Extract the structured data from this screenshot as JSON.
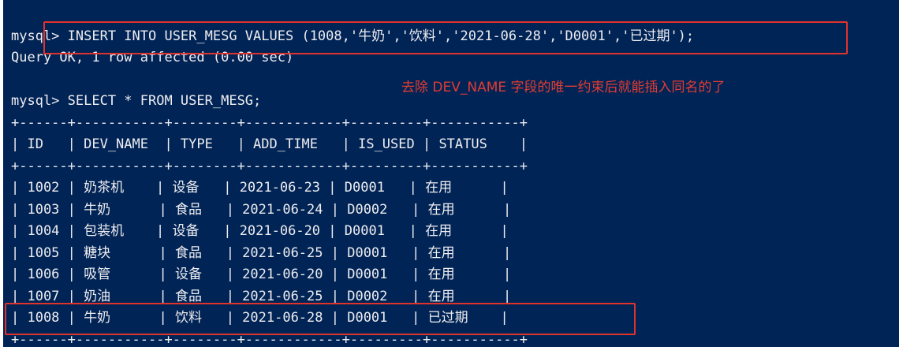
{
  "terminal": {
    "insert_command": "mysql> INSERT INTO USER_MESG VALUES (1008,'牛奶','饮料','2021-06-28','D0001','已过期');",
    "insert_result": "Query OK, 1 row affected (0.00 sec)",
    "select_command": "mysql> SELECT * FROM USER_MESG;",
    "separator": "+------+-----------+--------+------------+---------+-----------+",
    "header_row": "| ID   | DEV_NAME  | TYPE   | ADD_TIME   | IS_USED | STATUS    |",
    "columns": [
      "ID",
      "DEV_NAME",
      "TYPE",
      "ADD_TIME",
      "IS_USED",
      "STATUS"
    ],
    "rows": [
      "| 1002 | 奶茶机    | 设备   | 2021-06-23 | D0001   | 在用      |",
      "| 1003 | 牛奶      | 食品   | 2021-06-24 | D0002   | 在用      |",
      "| 1004 | 包装机    | 设备   | 2021-06-20 | D0001   | 在用      |",
      "| 1005 | 糖块      | 食品   | 2021-06-25 | D0001   | 在用      |",
      "| 1006 | 吸管      | 设备   | 2021-06-20 | D0001   | 在用      |",
      "| 1007 | 奶油      | 食品   | 2021-06-25 | D0002   | 在用      |",
      "| 1008 | 牛奶      | 饮料   | 2021-06-28 | D0001   | 已过期    |"
    ]
  },
  "annotation": {
    "note": "去除 DEV_NAME 字段的唯一约束后就能插入同名的了",
    "color": "#e0332b"
  },
  "colors": {
    "background": "#012456",
    "text": "#eeedf0"
  }
}
